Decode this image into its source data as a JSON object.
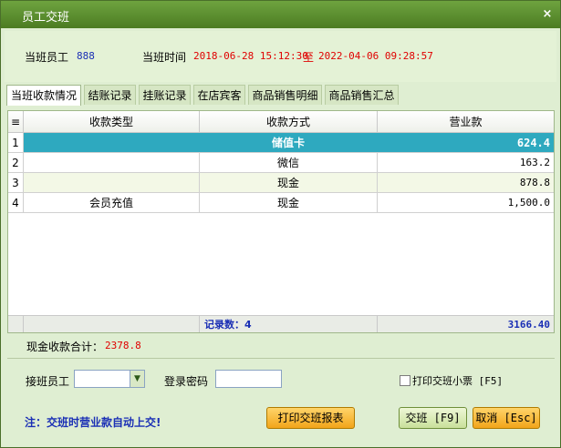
{
  "window": {
    "title": "员工交班",
    "close_glyph": "×"
  },
  "info": {
    "on_duty_label": "当班员工",
    "on_duty_value": "888",
    "time_label": "当班时间",
    "time_start": "2018-06-28 15:12:30",
    "time_sep": "至",
    "time_end": "2022-04-06 09:28:57"
  },
  "tabs": [
    {
      "label": "当班收款情况",
      "active": true
    },
    {
      "label": "结账记录",
      "active": false
    },
    {
      "label": "挂账记录",
      "active": false
    },
    {
      "label": "在店宾客",
      "active": false
    },
    {
      "label": "商品销售明细",
      "active": false
    },
    {
      "label": "商品销售汇总",
      "active": false
    }
  ],
  "table": {
    "row_icon": "≡",
    "columns": [
      "收款类型",
      "收款方式",
      "营业款"
    ],
    "rows": [
      {
        "no": "1",
        "type": "",
        "method": "储值卡",
        "amount": "624.4"
      },
      {
        "no": "2",
        "type": "",
        "method": "微信",
        "amount": "163.2"
      },
      {
        "no": "3",
        "type": "",
        "method": "现金",
        "amount": "878.8"
      },
      {
        "no": "4",
        "type": "会员充值",
        "method": "现金",
        "amount": "1,500.0"
      }
    ],
    "footer": {
      "count_label": "记录数：4",
      "total": "3166.40"
    }
  },
  "cash_total": {
    "label": "现金收款合计：",
    "value": "2378.8"
  },
  "handover": {
    "next_staff_label": "接班员工",
    "next_staff_value": "",
    "password_label": "登录密码",
    "password_value": "",
    "print_receipt_label": "打印交班小票 [F5]"
  },
  "buttons": {
    "print_report": "打印交班报表",
    "handover": "交班 [F9]",
    "cancel": "取消 [Esc]"
  },
  "note": "注：交班时营业款自动上交!",
  "colors": {
    "titlebar": "#5a8f2f",
    "selected_row": "#2ea9bf",
    "accent_blue": "#1a2fb5",
    "accent_red": "#e00000"
  }
}
